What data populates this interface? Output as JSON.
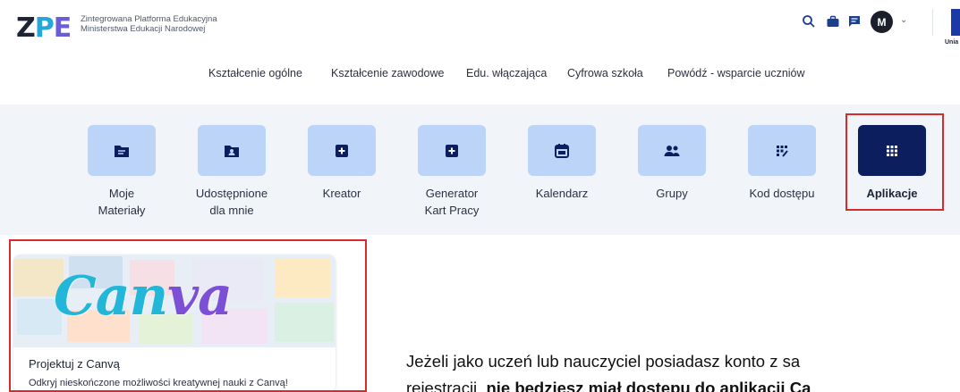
{
  "header": {
    "logo": {
      "z": "Z",
      "p": "P",
      "e": "E"
    },
    "tagline_line1": "Zintegrowana Platforma Edukacyjna",
    "tagline_line2": "Ministerstwa Edukacji Narodowej",
    "avatar_initial": "M",
    "eu_label": "Unia",
    "icons": [
      "search-icon",
      "briefcase-icon",
      "chat-icon",
      "chevron-down-icon"
    ]
  },
  "nav": {
    "items": [
      {
        "label": "Kształcenie ogólne"
      },
      {
        "label": "Kształcenie zawodowe"
      },
      {
        "label": "Edu. włączająca"
      },
      {
        "label": "Cyfrowa szkoła"
      },
      {
        "label": "Powódź - wsparcie uczniów"
      }
    ]
  },
  "tiles": [
    {
      "line1": "Moje",
      "line2": "Materiały",
      "icon": "folder-doc-icon"
    },
    {
      "line1": "Udostępnione",
      "line2": "dla mnie",
      "icon": "shared-folder-icon"
    },
    {
      "line1": "Kreator",
      "line2": "",
      "icon": "plus-box-icon"
    },
    {
      "line1": "Generator",
      "line2": "Kart Pracy",
      "icon": "plus-box-icon"
    },
    {
      "line1": "Kalendarz",
      "line2": "",
      "icon": "calendar-icon"
    },
    {
      "line1": "Grupy",
      "line2": "",
      "icon": "group-icon"
    },
    {
      "line1": "Kod dostępu",
      "line2": "",
      "icon": "access-code-icon"
    },
    {
      "line1": "Aplikacje",
      "line2": "",
      "icon": "apps-grid-icon",
      "active": true
    }
  ],
  "card": {
    "logo_main": "Can",
    "logo_tail": "va",
    "title": "Projektuj z Canvą",
    "description": "Odkryj nieskończone możliwości kreatywnej nauki z Canvą!"
  },
  "body_text": {
    "line1": "Jeżeli jako uczeń lub nauczyciel posiadasz konto z sa",
    "line2_prefix": "rejestracji, ",
    "line2_bold": "nie będziesz miał dostępu do aplikacji Ca"
  },
  "colors": {
    "tile_bg": "#bcd4f7",
    "tile_active_bg": "#0d1e5e",
    "highlight_border": "#d52b2b",
    "band_bg": "#f1f4f9"
  }
}
